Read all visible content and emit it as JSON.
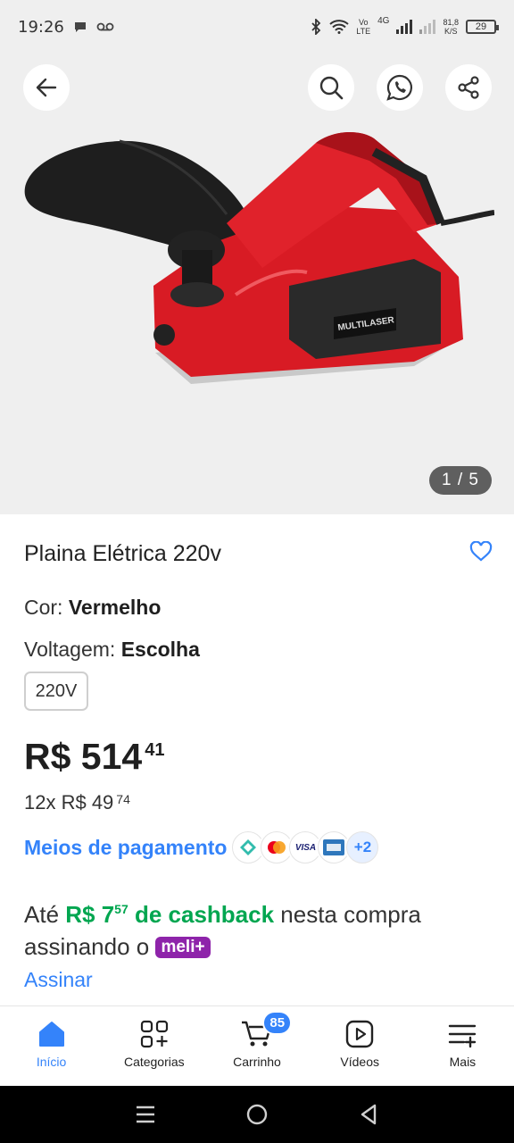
{
  "status": {
    "time": "19:26",
    "volte_top": "Vo",
    "volte_bottom": "LTE",
    "net_type": "4G",
    "speed_top": "81,8",
    "speed_bottom": "K/S",
    "battery": "29"
  },
  "gallery": {
    "counter": "1 / 5",
    "brand_text": "MULTILASER"
  },
  "product": {
    "title": "Plaina Elétrica 220v",
    "color_label": "Cor: ",
    "color_value": "Vermelho",
    "voltage_label": "Voltagem: ",
    "voltage_value": "Escolha",
    "voltage_option": "220V",
    "price_main": "R$ 514",
    "price_cents": "41",
    "installments_prefix": "12x R$ 49",
    "installments_cents": "74",
    "payment_link": "Meios de pagamento",
    "payment_more": "+2",
    "cashback_prefix": "Até ",
    "cashback_value": "R$ 7",
    "cashback_cents": "57",
    "cashback_label": " de cashback",
    "cashback_suffix": " nesta compra assinando o ",
    "meli_badge": "meli+",
    "subscribe": "Assinar"
  },
  "bottom_nav": {
    "items": [
      {
        "label": "Início",
        "icon": "home-icon",
        "active": true
      },
      {
        "label": "Categorias",
        "icon": "categories-icon"
      },
      {
        "label": "Carrinho",
        "icon": "cart-icon",
        "badge": "85"
      },
      {
        "label": "Vídeos",
        "icon": "video-icon"
      },
      {
        "label": "Mais",
        "icon": "menu-plus-icon"
      }
    ]
  },
  "colors": {
    "accent": "#3483fa",
    "cashback_green": "#00a650",
    "meli_purple": "#8e24aa",
    "product_red": "#d81b24"
  }
}
